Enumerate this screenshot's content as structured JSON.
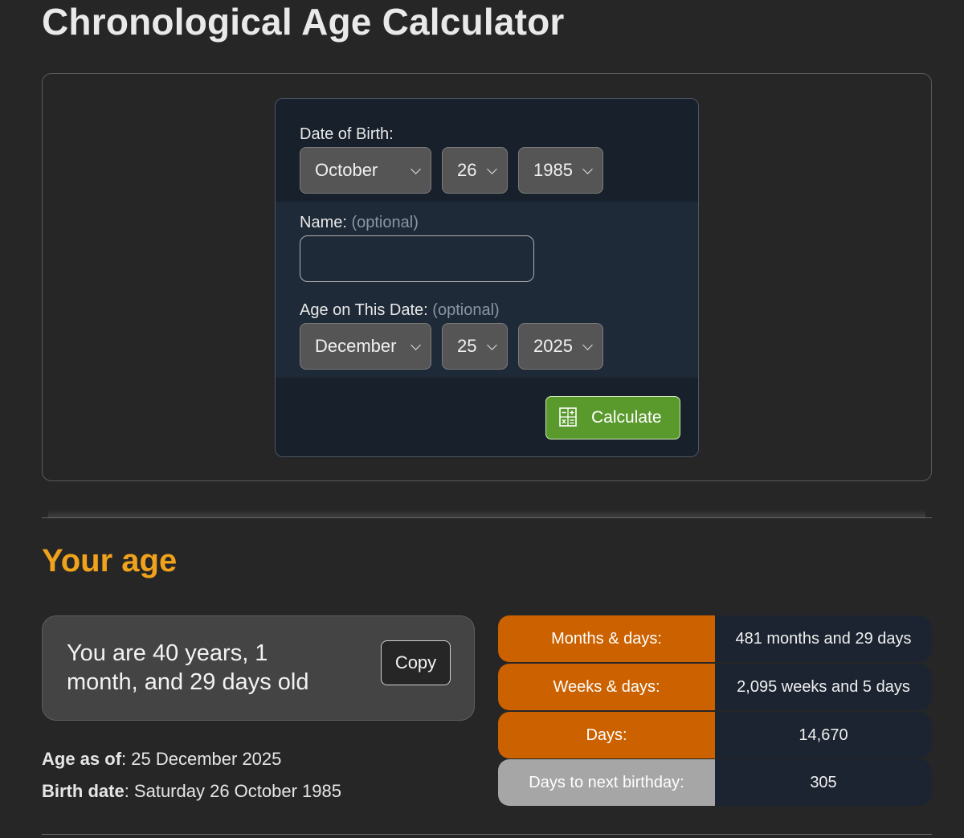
{
  "page_title": "Chronological Age Calculator",
  "form": {
    "dob_label": "Date of Birth:",
    "dob": {
      "month": "October",
      "day": "26",
      "year": "1985"
    },
    "name_label": "Name:",
    "name_optional": "(optional)",
    "name_value": "",
    "age_on_label": "Age on This Date:",
    "age_on_optional": "(optional)",
    "age_on": {
      "month": "December",
      "day": "25",
      "year": "2025"
    },
    "calculate_label": "Calculate",
    "calculate_icon": "calculator-icon"
  },
  "results": {
    "title": "Your age",
    "summary": "You are 40 years, 1 month, and 29 days old",
    "copy_label": "Copy",
    "age_as_of_label": "Age as of",
    "age_as_of_value": "25 December 2025",
    "birth_date_label": "Birth date",
    "birth_date_value": "Saturday 26 October 1985",
    "stats": [
      {
        "label": "Months & days:",
        "value": "481 months and 29 days"
      },
      {
        "label": "Weeks & days:",
        "value": "2,095 weeks and 5 days"
      },
      {
        "label": "Days:",
        "value": "14,670"
      },
      {
        "label": "Days to next birthday:",
        "value": "305"
      }
    ]
  },
  "colors": {
    "accent_orange": "#cc6100",
    "title_orange": "#f0a21c",
    "calculate_green": "#5a9a2d",
    "panel_navy": "#17202b"
  }
}
